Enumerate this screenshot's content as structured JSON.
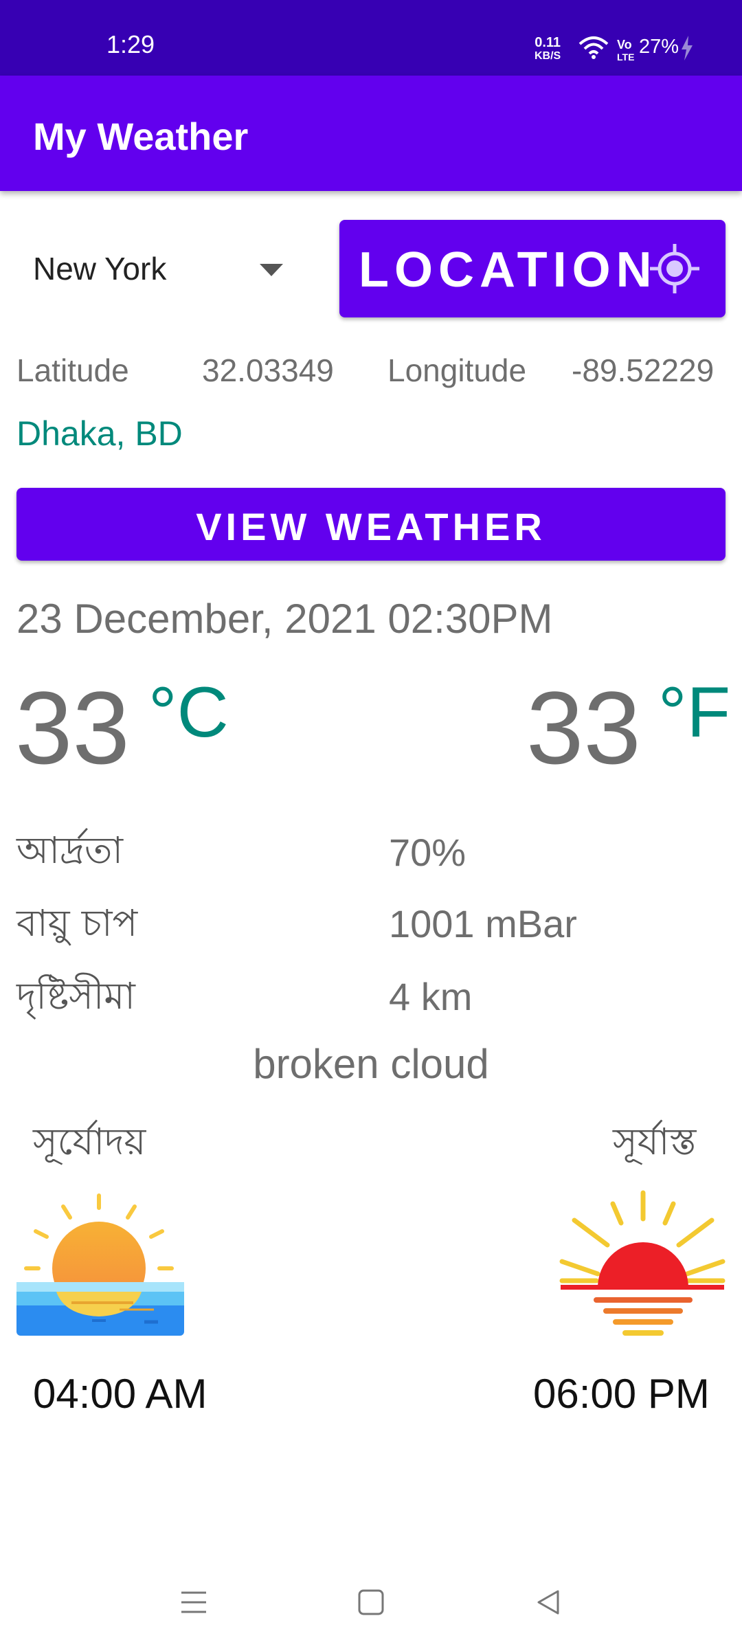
{
  "status_bar": {
    "time": "1:29",
    "net_speed_value": "0.11",
    "net_speed_unit": "KB/S",
    "volte_top": "Vo",
    "volte_bottom": "LTE",
    "battery": "27%"
  },
  "app_bar": {
    "title": "My Weather"
  },
  "city_spinner": {
    "selected": "New York"
  },
  "location_button": {
    "label": "LOCATION"
  },
  "coordinates": {
    "latitude_label": "Latitude",
    "latitude_value": "32.03349",
    "longitude_label": "Longitude",
    "longitude_value": "-89.52229"
  },
  "place_name": "Dhaka, BD",
  "view_weather_button": {
    "label": "VIEW WEATHER"
  },
  "weather": {
    "date_time": "23 December, 2021 02:30PM",
    "temp_c": "33",
    "unit_c": "°C",
    "temp_f": "33",
    "unit_f": "°F",
    "humidity_label": "আর্দ্রতা",
    "humidity_value": "70%",
    "pressure_label": "বায়ু চাপ",
    "pressure_value": "1001 mBar",
    "visibility_label": "দৃষ্টিসীমা",
    "visibility_value": "4 km",
    "description": "broken cloud"
  },
  "sun": {
    "sunrise_label": "সূর্যোদয়",
    "sunrise_time": "04:00 AM",
    "sunset_label": "সূর্যাস্ত",
    "sunset_time": "06:00 PM"
  },
  "colors": {
    "primary": "#6200EE",
    "primary_dark": "#3700B3",
    "accent_teal": "#00897B",
    "text_gray": "#6e6e6e"
  },
  "icons": [
    "wifi-icon",
    "charging-icon",
    "location-target-icon",
    "dropdown-arrow-icon",
    "sunrise-icon",
    "sunset-icon",
    "menu-icon",
    "home-icon",
    "back-icon"
  ]
}
